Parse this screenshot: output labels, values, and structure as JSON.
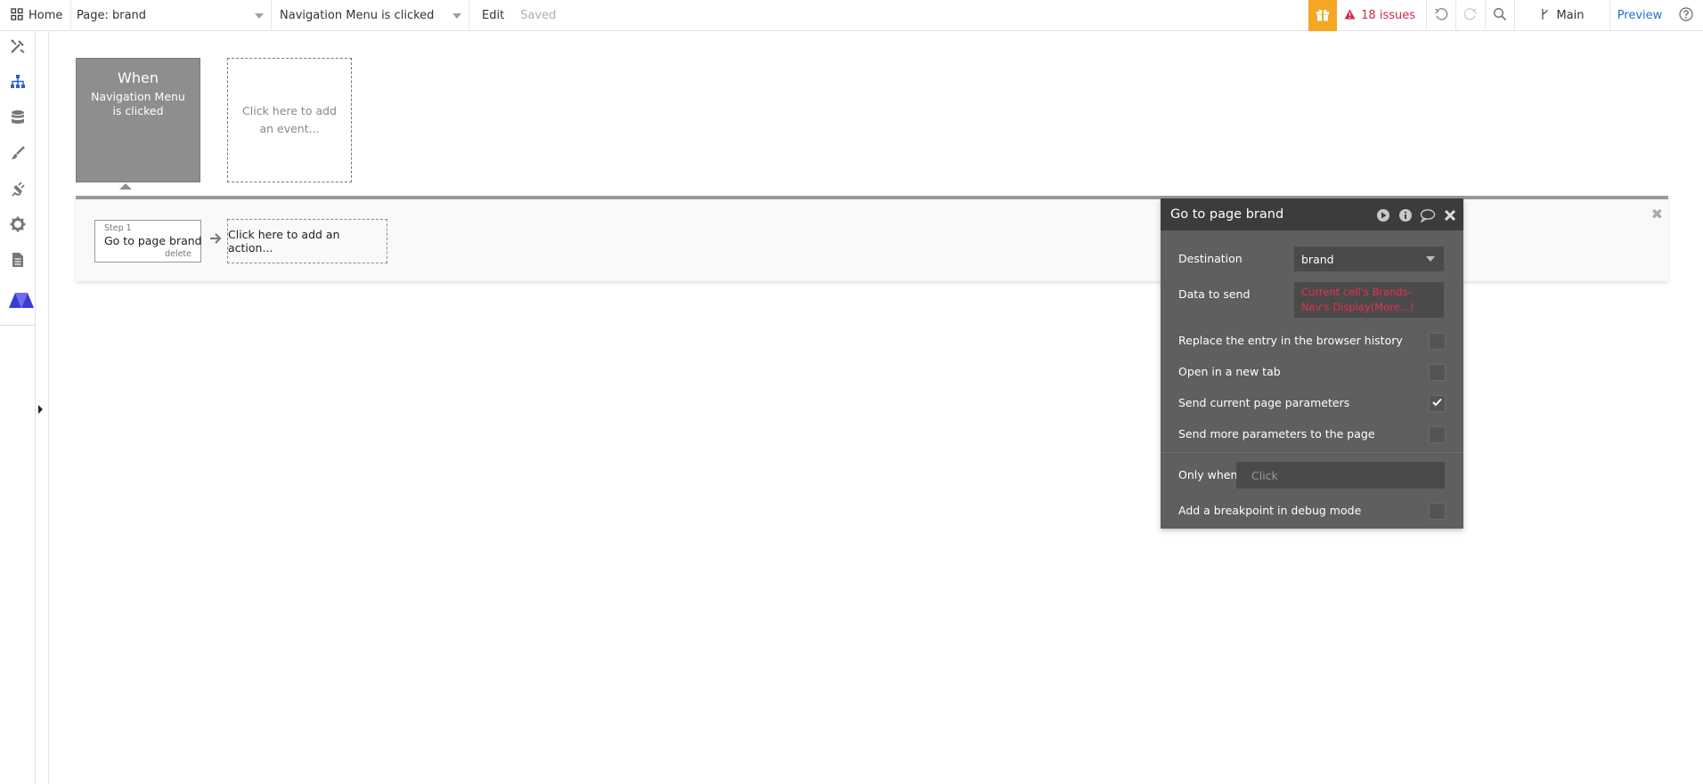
{
  "topbar": {
    "home_label": "Home",
    "page_label": "Page: brand",
    "event_label": "Navigation Menu is clicked",
    "edit_label": "Edit",
    "saved_label": "Saved",
    "issues_label": "18 issues",
    "branch_label": "Main",
    "preview_label": "Preview"
  },
  "sidebar": {
    "items": [
      "design-icon",
      "workflow-icon",
      "data-icon",
      "styles-icon",
      "plugins-icon",
      "settings-icon",
      "logs-icon",
      "bubble-logo-icon"
    ]
  },
  "event": {
    "when_label": "When",
    "trigger_label": "Navigation Menu is clicked",
    "add_event_label": "Click here to add an event..."
  },
  "actions": {
    "step_num": "Step 1",
    "step_title": "Go to page brand",
    "delete_label": "delete",
    "add_action_label": "Click here to add an action..."
  },
  "panel": {
    "title": "Go to page brand",
    "destination_label": "Destination",
    "destination_value": "brand",
    "data_label": "Data to send",
    "data_value": "Current cell's Brands-Nav's Display(More...)",
    "replace_history_label": "Replace the entry in the browser history",
    "new_tab_label": "Open in a new tab",
    "send_current_label": "Send current page parameters",
    "send_more_label": "Send more parameters to the page",
    "only_when_label": "Only when",
    "only_when_placeholder": "Click",
    "breakpoint_label": "Add a breakpoint in debug mode",
    "checks": {
      "replace_history": false,
      "new_tab": false,
      "send_current": true,
      "send_more": false,
      "breakpoint": false
    }
  },
  "colors": {
    "accent_blue": "#1b73d6",
    "issues_red": "#d8264b",
    "gift_orange": "#f5a623",
    "expression_red": "#ea2d55",
    "logo_purple": "#3b3bd6"
  }
}
